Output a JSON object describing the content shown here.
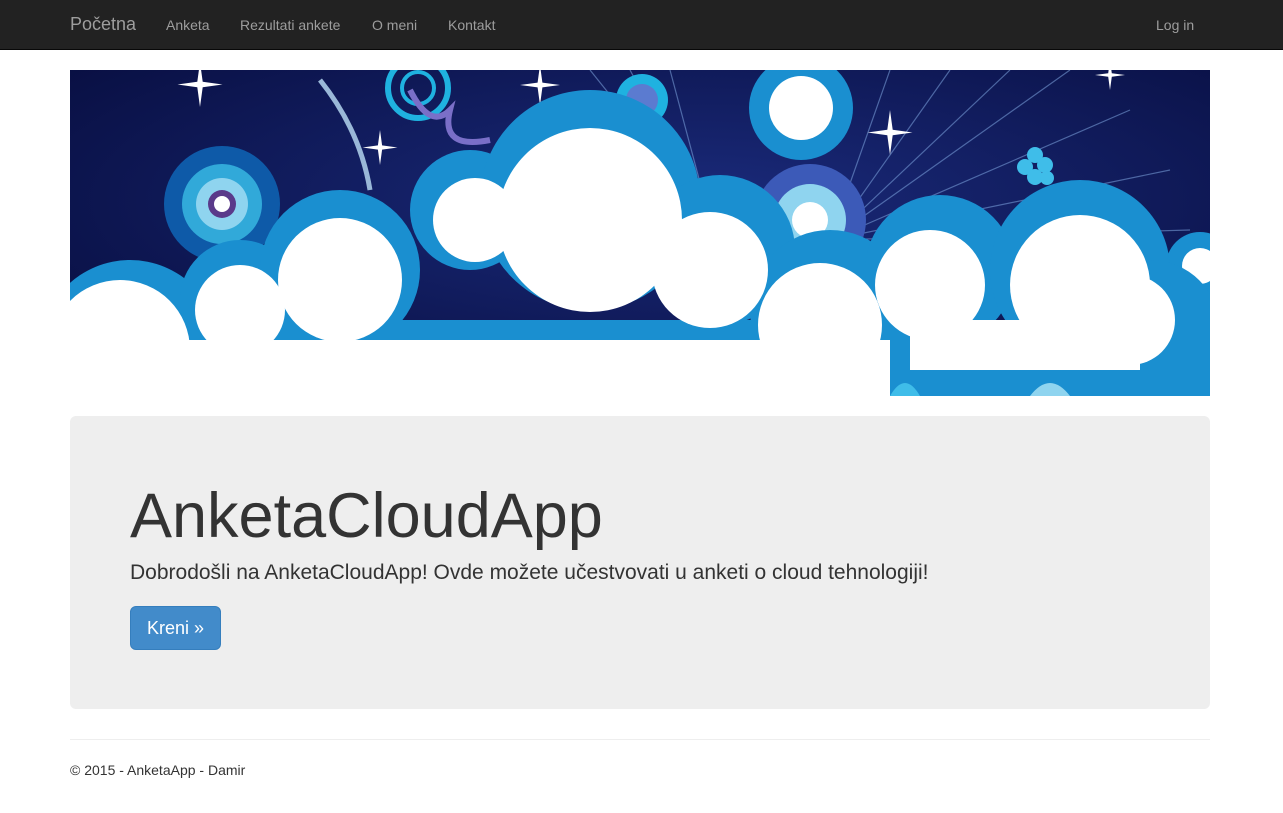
{
  "navbar": {
    "brand": "Početna",
    "items": [
      {
        "label": "Anketa"
      },
      {
        "label": "Rezultati ankete"
      },
      {
        "label": "O meni"
      },
      {
        "label": "Kontakt"
      }
    ],
    "login": "Log in"
  },
  "banner": {
    "image": "cloud-banner-illustration",
    "colors": {
      "background": "#070d3f",
      "cloud_outline": "#1a8fd0",
      "cloud_fill": "#ffffff",
      "accent": "#1fb2e0"
    }
  },
  "jumbotron": {
    "title": "AnketaCloudApp",
    "lead": "Dobrodošli na AnketaCloudApp! Ovde možete učestvovati u anketi o cloud tehnologiji!",
    "button_label": "Kreni »"
  },
  "footer": {
    "text": "© 2015 - AnketaApp - Damir"
  },
  "colors": {
    "navbar_bg": "#222222",
    "nav_link": "#9d9d9d",
    "jumbotron_bg": "#eeeeee",
    "primary_button": "#428bca"
  }
}
